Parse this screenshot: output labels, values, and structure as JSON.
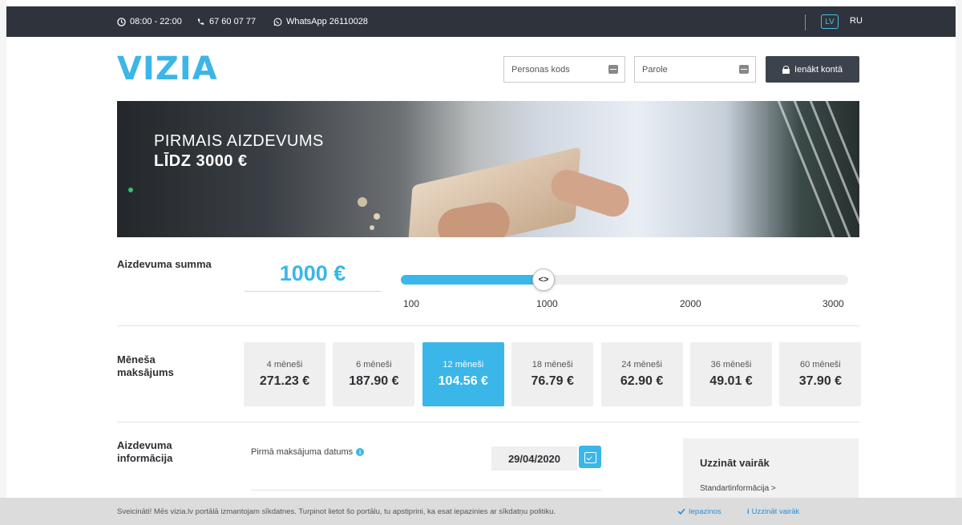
{
  "topbar": {
    "hours": "08:00 - 22:00",
    "phone": "67 60 07 77",
    "whatsapp": "WhatsApp 26110028",
    "lang_active": "LV",
    "lang_other": "RU"
  },
  "header": {
    "logo": "VIZIA",
    "personal_code_placeholder": "Personas kods",
    "password_placeholder": "Parole",
    "login_label": "Ienākt kontā"
  },
  "hero": {
    "line1": "PIRMAIS AIZDEVUMS",
    "line2": "LĪDZ 3000 €"
  },
  "amount": {
    "label": "Aizdevuma summa",
    "value": "1000 €",
    "handle_glyph": "<>",
    "slider_min": 100,
    "slider_max": 3000,
    "slider_value": 1000,
    "ticks": [
      "100",
      "1000",
      "2000",
      "3000"
    ]
  },
  "monthly": {
    "label_line1": "Mēneša",
    "label_line2": "maksājums",
    "options": [
      {
        "term": "4 mēneši",
        "amount": "271.23 €"
      },
      {
        "term": "6 mēneši",
        "amount": "187.90 €"
      },
      {
        "term": "12 mēneši",
        "amount": "104.56 €",
        "active": true
      },
      {
        "term": "18 mēneši",
        "amount": "76.79 €"
      },
      {
        "term": "24 mēneši",
        "amount": "62.90 €"
      },
      {
        "term": "36 mēneši",
        "amount": "49.01 €"
      },
      {
        "term": "60 mēneši",
        "amount": "37.90 €"
      }
    ]
  },
  "loan_info": {
    "label_line1": "Aizdevuma",
    "label_line2": "informācija",
    "first_payment_label": "Pirmā maksājuma datums",
    "first_payment_date": "29/04/2020"
  },
  "learn_more": {
    "title": "Uzzināt vairāk",
    "link": "Standartinformācija  >"
  },
  "cookie": {
    "text": "Sveicināti! Mēs vizia.lv portālā izmantojam sīkdatnes. Turpinot lietot šo portālu, tu apstiprini, ka esat iepazinies ar sīkdatņu politiku.",
    "accept": "Iepazinos",
    "more": "Uzzināt vairāk"
  },
  "colors": {
    "accent": "#3bb6e8",
    "topbar": "#2f333b",
    "button_dark": "#3d434c"
  }
}
